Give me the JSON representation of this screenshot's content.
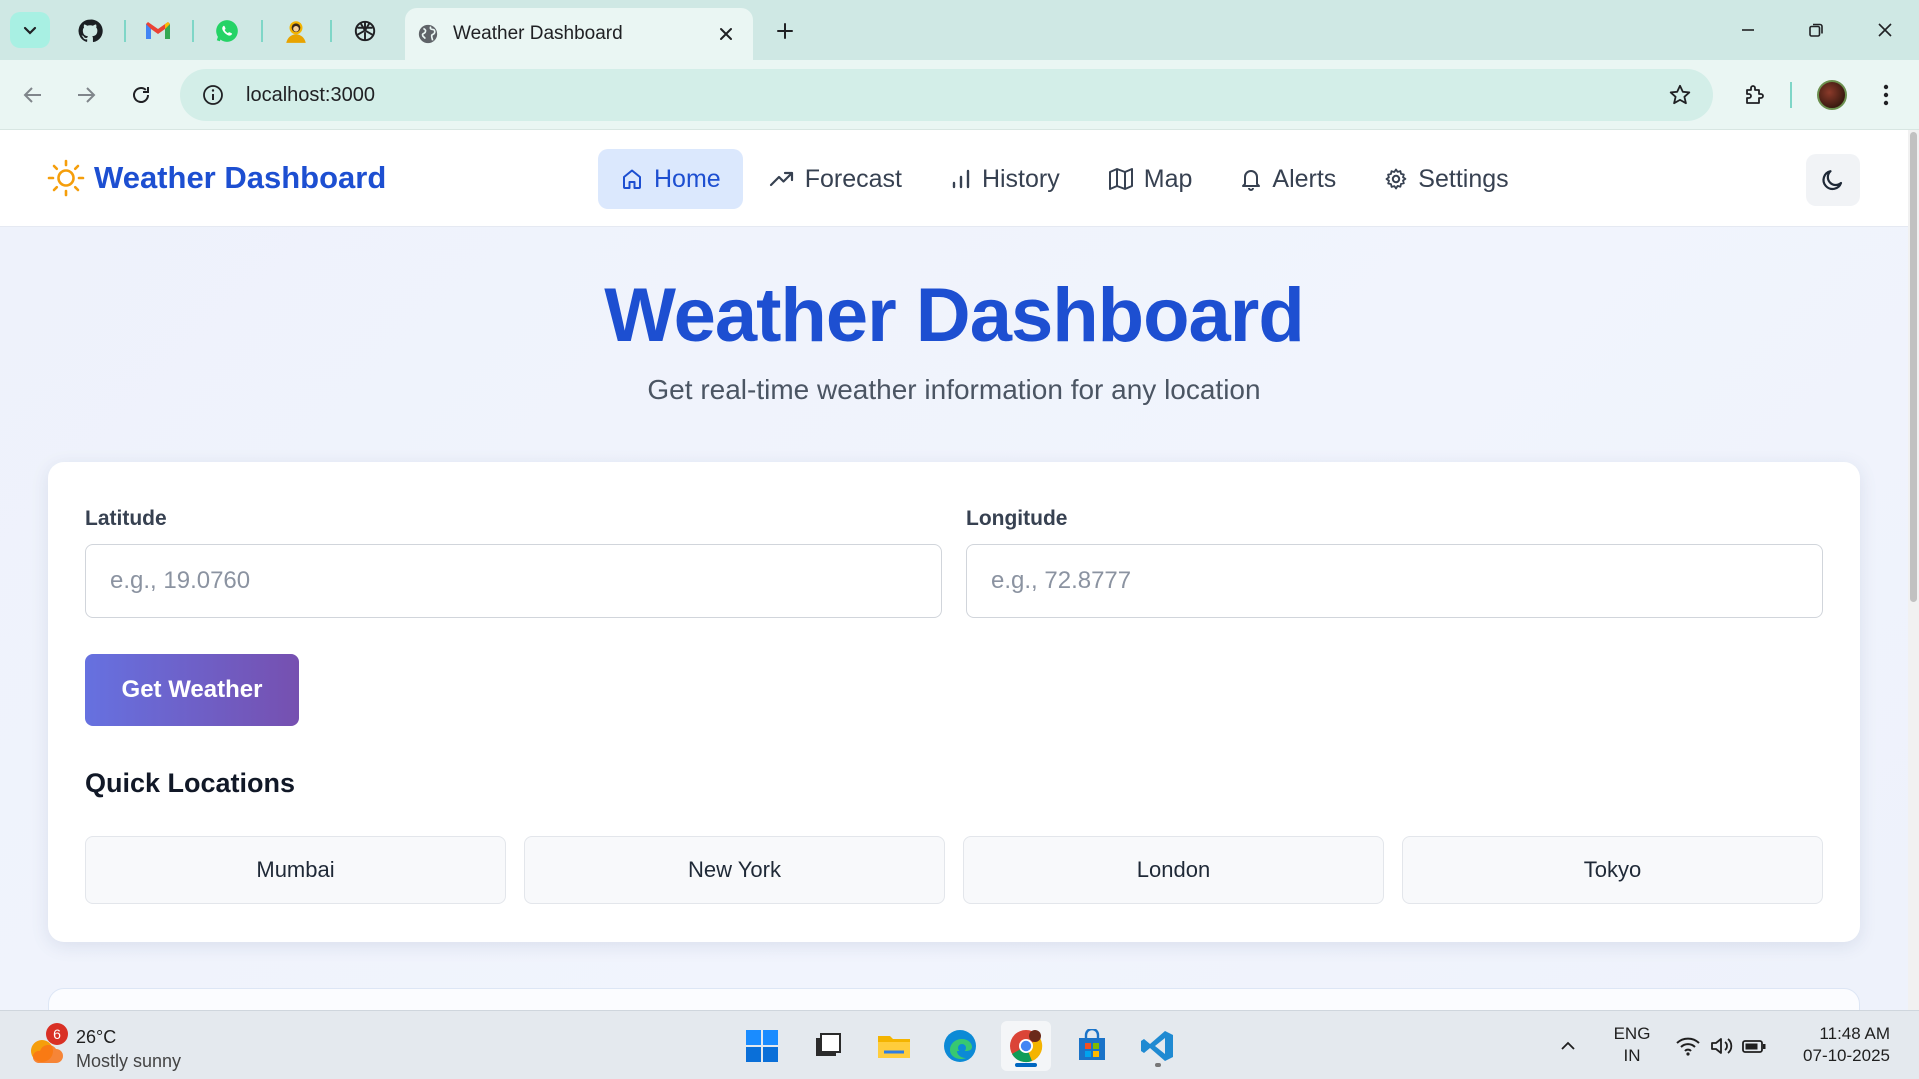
{
  "browser": {
    "tab_title": "Weather Dashboard",
    "url": "localhost:3000",
    "pinned_tabs": [
      "github-icon",
      "gmail-icon",
      "whatsapp-icon",
      "profile-app-icon",
      "chatgpt-icon"
    ]
  },
  "app": {
    "brand": "Weather Dashboard",
    "nav": [
      {
        "label": "Home",
        "icon": "home-icon",
        "active": true
      },
      {
        "label": "Forecast",
        "icon": "trending-up-icon"
      },
      {
        "label": "History",
        "icon": "bar-chart-icon"
      },
      {
        "label": "Map",
        "icon": "map-icon"
      },
      {
        "label": "Alerts",
        "icon": "bell-icon"
      },
      {
        "label": "Settings",
        "icon": "gear-icon"
      }
    ],
    "theme_toggle_icon": "moon-icon"
  },
  "hero": {
    "title": "Weather Dashboard",
    "subtitle": "Get real-time weather information for any location"
  },
  "form": {
    "latitude": {
      "label": "Latitude",
      "placeholder": "e.g., 19.0760",
      "value": ""
    },
    "longitude": {
      "label": "Longitude",
      "placeholder": "e.g., 72.8777",
      "value": ""
    },
    "submit_label": "Get Weather"
  },
  "quick_locations": {
    "title": "Quick Locations",
    "items": [
      "Mumbai",
      "New York",
      "London",
      "Tokyo"
    ]
  },
  "taskbar": {
    "weather": {
      "badge": "6",
      "temp": "26°C",
      "condition": "Mostly sunny"
    },
    "language": {
      "line1": "ENG",
      "line2": "IN"
    },
    "time": "11:48 AM",
    "date": "07-10-2025"
  },
  "colors": {
    "brand_blue": "#1d4fd1",
    "active_nav_bg": "#dbe8fd",
    "button_gradient_start": "#6671e0",
    "button_gradient_end": "#7650b0"
  }
}
